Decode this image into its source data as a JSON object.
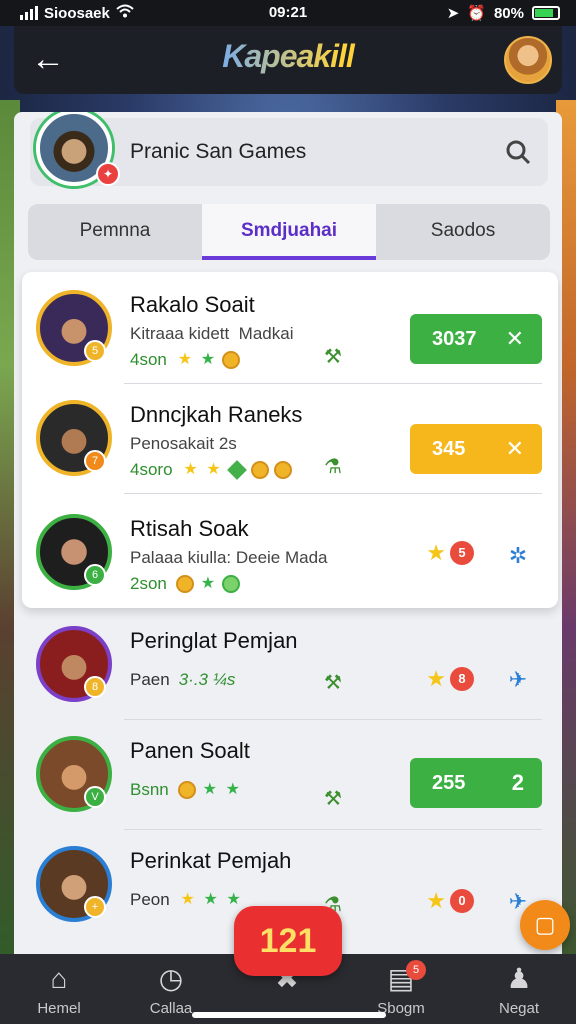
{
  "status_bar": {
    "carrier": "Sioosaek",
    "time": "09:21",
    "battery": "80%"
  },
  "header": {
    "title": "Kapeakill",
    "back_icon": "arrow-left-icon"
  },
  "profile": {
    "name": "Pranic San Games",
    "search_icon": "search-icon"
  },
  "tabs": [
    {
      "label": "Pemnna"
    },
    {
      "label": "Smdjuahai",
      "active": true
    },
    {
      "label": "Saodos"
    }
  ],
  "rows": [
    {
      "title": "Rakalo Soait",
      "subtitle": "Kitraaa kidett  Madkai",
      "count": "4son",
      "score": "3037",
      "action": "✕"
    },
    {
      "title": "Dnncjkah Raneks",
      "subtitle": "Penosakait 2s",
      "count": "4soro",
      "score": "345",
      "action": "✕"
    },
    {
      "title": "Rtisah Soak",
      "subtitle": "Palaaa kiulla: Deeie Mada",
      "count": "2son",
      "rank": "5"
    },
    {
      "title": "Peringlat Pemjan",
      "subtitle": "Paen",
      "meta_text": "3·.3 ¼s",
      "rank": "8"
    },
    {
      "title": "Panen Soalt",
      "subtitle": "Bsnn",
      "score": "255",
      "action": "2"
    },
    {
      "title": "Perinkat Pemjah",
      "subtitle": "Peon",
      "rank": "0"
    }
  ],
  "center_badge": "121",
  "nav": [
    {
      "label": "Hemel",
      "icon": "home-icon"
    },
    {
      "label": "Callaa",
      "icon": "clock-icon"
    },
    {
      "label": "",
      "icon": "game-icon"
    },
    {
      "label": "Sbogm",
      "icon": "inbox-icon",
      "badge": "5"
    },
    {
      "label": "Negat",
      "icon": "bell-icon"
    }
  ],
  "colors": {
    "accent": "#6a3bd9",
    "green": "#3cb043",
    "yellow": "#f5b71b",
    "red": "#e92f2f"
  }
}
